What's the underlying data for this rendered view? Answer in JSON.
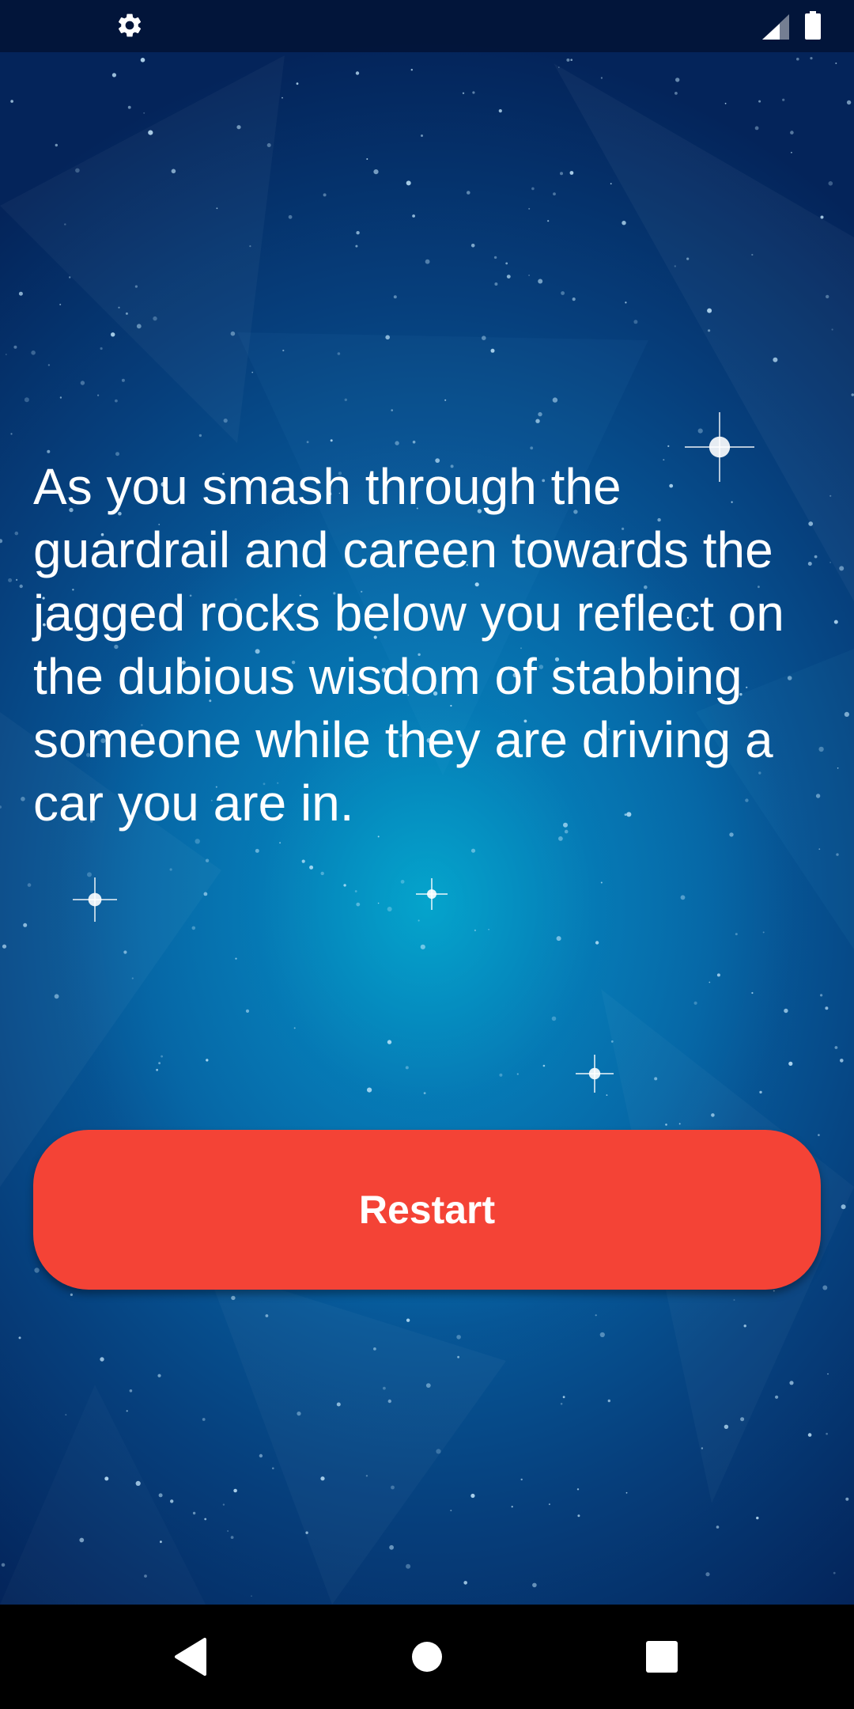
{
  "status_bar": {
    "left_icon": "gear-icon",
    "right_icons": [
      "cellular-signal-icon",
      "battery-icon"
    ]
  },
  "story": {
    "text": "As you smash through the guardrail and careen towards the jagged rocks below you reflect on the dubious wisdom of stabbing someone while they are driving a car you are in."
  },
  "actions": {
    "restart_label": "Restart"
  },
  "nav_bar": {
    "icons": [
      "back-triangle-icon",
      "home-circle-icon",
      "recents-square-icon"
    ]
  },
  "colors": {
    "button": "#f44336",
    "text": "#ffffff",
    "background_deep": "#04245a",
    "background_glow": "#0a78b8",
    "nav_bar": "#000000"
  }
}
